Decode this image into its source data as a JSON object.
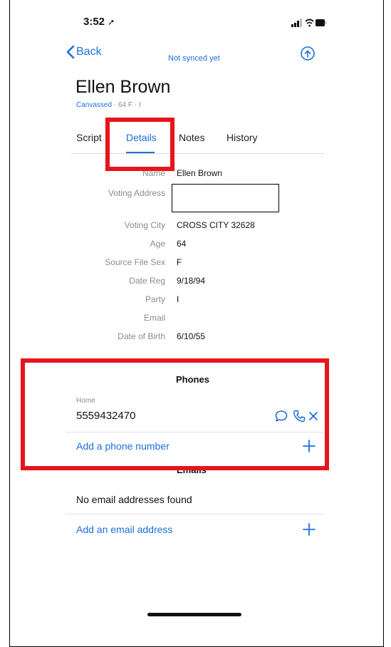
{
  "status_bar": {
    "time": "3:52",
    "location_icon": "location-arrow-icon",
    "signal_icon": "signal-icon",
    "wifi_icon": "wifi-icon",
    "battery_icon": "battery-icon"
  },
  "nav": {
    "back_label": "Back",
    "sync_status": "Not synced yet",
    "upload_icon": "cloud-upload-icon"
  },
  "contact": {
    "name": "Ellen Brown",
    "status": "Canvassed",
    "meta": " · 64  F · I"
  },
  "tabs": [
    {
      "label": "Script",
      "active": false
    },
    {
      "label": "Details",
      "active": true
    },
    {
      "label": "Notes",
      "active": false
    },
    {
      "label": "History",
      "active": false
    }
  ],
  "details": [
    {
      "label": "Name",
      "value": "Ellen Brown"
    },
    {
      "label": "Voting Address",
      "value": ""
    },
    {
      "label": "Voting City",
      "value": "CROSS CITY 32628"
    },
    {
      "label": "Age",
      "value": "64"
    },
    {
      "label": "Source File Sex",
      "value": "F"
    },
    {
      "label": "Date Reg",
      "value": "9/18/94"
    },
    {
      "label": "Party",
      "value": "I"
    },
    {
      "label": "Email",
      "value": ""
    },
    {
      "label": "Date of Birth",
      "value": "6/10/55"
    }
  ],
  "phones": {
    "heading": "Phones",
    "items": [
      {
        "type": "Home",
        "number": "5559432470"
      }
    ],
    "add_label": "Add a phone number"
  },
  "emails": {
    "heading": "Emails",
    "empty_text": "No email addresses found",
    "add_label": "Add an email address"
  },
  "colors": {
    "accent": "#1e6fe0",
    "highlight": "#e8141b",
    "label_gray": "#8c8c8c"
  }
}
